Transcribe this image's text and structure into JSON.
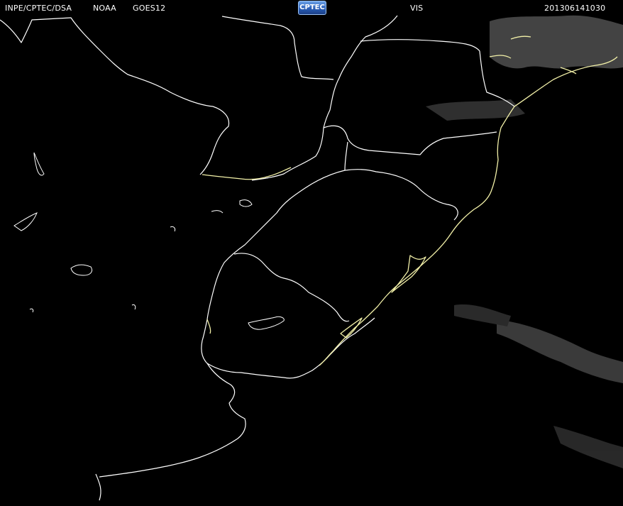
{
  "header": {
    "source_label": "INPE/CPTEC/DSA",
    "agency_label": "NOAA",
    "satellite_label": "GOES12",
    "logo_text": "CPTEC",
    "channel_label": "VIS",
    "timestamp": "201306141030"
  },
  "map": {
    "background_color": "#000000",
    "border_color": "#ffffff",
    "coast_highlight_color": "#f2f0a8",
    "cloud_color": "#8a8a8a"
  }
}
